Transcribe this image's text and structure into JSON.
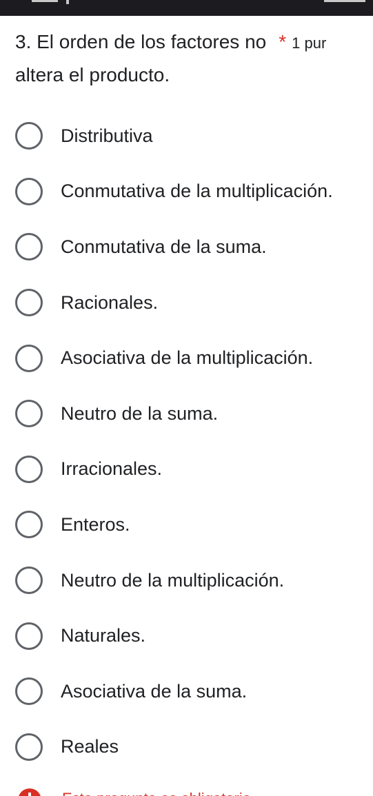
{
  "question": {
    "number_and_title_line1": "3. El orden de los factores no",
    "title_line2": "altera el producto.",
    "required_marker": "*",
    "points": "1 pur"
  },
  "options": [
    {
      "label": "Distributiva"
    },
    {
      "label": "Conmutativa de la multiplicación."
    },
    {
      "label": "Conmutativa de la suma."
    },
    {
      "label": "Racionales."
    },
    {
      "label": "Asociativa de la multiplicación."
    },
    {
      "label": "Neutro de la suma."
    },
    {
      "label": "Irracionales."
    },
    {
      "label": "Enteros."
    },
    {
      "label": "Neutro de la multiplicación."
    },
    {
      "label": "Naturales."
    },
    {
      "label": "Asociativa de la suma."
    },
    {
      "label": "Reales"
    }
  ],
  "footer": {
    "warning_text": "Esta pregunta es obligatoria",
    "icon": "error-icon",
    "color": "#d93025"
  }
}
